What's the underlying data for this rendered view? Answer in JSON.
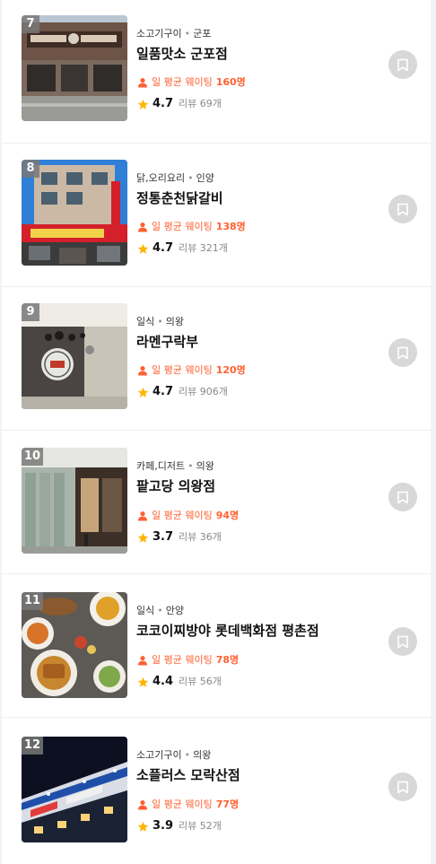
{
  "labels": {
    "wait_prefix": "일 평균 웨이팅",
    "review_prefix": "리뷰"
  },
  "colors": {
    "accent": "#ff6132",
    "star": "#ffb400",
    "rank_badge": "#787878",
    "bookmark_bg": "#d8d8d8"
  },
  "icons": {
    "wait": "person-icon",
    "rating": "star-icon",
    "save": "bookmark-icon"
  },
  "restaurants": [
    {
      "rank": "7",
      "category": "소고기구이",
      "area": "군포",
      "name": "일품맛소 군포점",
      "wait": "160명",
      "score": "4.7",
      "reviews": "69개"
    },
    {
      "rank": "8",
      "category": "닭,오리요리",
      "area": "인양",
      "name": "정통춘천닭갈비",
      "wait": "138명",
      "score": "4.7",
      "reviews": "321개"
    },
    {
      "rank": "9",
      "category": "일식",
      "area": "의왕",
      "name": "라멘구락부",
      "wait": "120명",
      "score": "4.7",
      "reviews": "906개"
    },
    {
      "rank": "10",
      "category": "카페,디저트",
      "area": "의왕",
      "name": "팥고당 의왕점",
      "wait": "94명",
      "score": "3.7",
      "reviews": "36개"
    },
    {
      "rank": "11",
      "category": "일식",
      "area": "안양",
      "name": "코코이찌방야 롯데백화점 평촌점",
      "wait": "78명",
      "score": "4.4",
      "reviews": "56개"
    },
    {
      "rank": "12",
      "category": "소고기구이",
      "area": "의왕",
      "name": "소플러스 모락산점",
      "wait": "77명",
      "score": "3.9",
      "reviews": "52개"
    }
  ]
}
